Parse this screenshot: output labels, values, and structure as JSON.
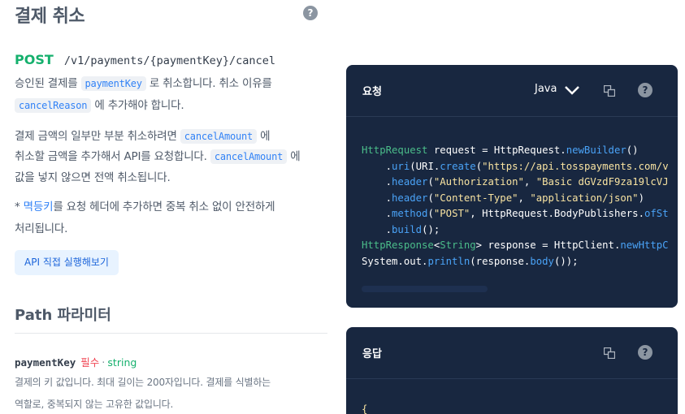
{
  "page": {
    "title": "결제 취소"
  },
  "endpoint": {
    "method": "POST",
    "path": "/v1/payments/{paymentKey}/cancel"
  },
  "description": {
    "p1_a": "승인된 결제를 ",
    "p1_code": "paymentKey",
    "p1_b": " 로 취소합니다. 취소 이유를",
    "p1_code2": "cancelReason",
    "p1_c": " 에 추가해야 합니다.",
    "p2_a": "결제 금액의 일부만 부분 취소하려면 ",
    "p2_code": "cancelAmount",
    "p2_b": " 에",
    "p2_c": "취소할 금액을 추가해서 API를 요청합니다. ",
    "p2_code2": "cancelAmount",
    "p2_d": " 에",
    "p2_e": "값을 넣지 않으면 전액 취소됩니다.",
    "p3_a": "* ",
    "p3_link": "멱등키",
    "p3_b": "를 요청 헤더에 추가하면 중복 취소 없이 안전하게",
    "p3_c": "처리됩니다."
  },
  "buttons": {
    "api_try": "API 직접 실행해보기"
  },
  "path_params": {
    "title": "Path 파라미터",
    "items": [
      {
        "name": "paymentKey",
        "required": "필수",
        "separator": "·",
        "type": "string",
        "desc_line1": "결제의 키 값입니다. 최대 길이는 200자입니다. 결제를 식별하는",
        "desc_line2": "역할로, 중복되지 않는 고유한 값입니다."
      }
    ]
  },
  "request_panel": {
    "title": "요청",
    "language": "Java",
    "code": {
      "l1_type": "HttpRequest",
      "l1_a": " request = HttpRequest.",
      "l1_fn": "newBuilder",
      "l1_b": "()",
      "l2_a": "    .",
      "l2_fn": "uri",
      "l2_b": "(URI.",
      "l2_fn2": "create",
      "l2_c": "(",
      "l2_str": "\"https://api.tosspayments.com/v",
      "l3_a": "    .",
      "l3_fn": "header",
      "l3_b": "(",
      "l3_str": "\"Authorization\"",
      "l3_c": ", ",
      "l3_str2": "\"Basic dGVzdF9za19lcVJ",
      "l4_a": "    .",
      "l4_fn": "header",
      "l4_b": "(",
      "l4_str": "\"Content-Type\"",
      "l4_c": ", ",
      "l4_str2": "\"application/json\"",
      "l4_d": ")",
      "l5_a": "    .",
      "l5_fn": "method",
      "l5_b": "(",
      "l5_str": "\"POST\"",
      "l5_c": ", HttpRequest.BodyPublishers.",
      "l5_fn2": "ofSt",
      "l6_a": "    .",
      "l6_fn": "build",
      "l6_b": "();",
      "l7_type": "HttpResponse",
      "l7_a": "<",
      "l7_type2": "String",
      "l7_b": "> response = HttpClient.",
      "l7_fn": "newHttpC",
      "l8_a": "System.out.",
      "l8_fn": "println",
      "l8_b": "(response.",
      "l8_fn2": "body",
      "l8_c": "());"
    }
  },
  "response_panel": {
    "title": "응답",
    "code_first": "{"
  },
  "colors": {
    "accent_green": "#15b06d",
    "accent_blue": "#3182f6",
    "required_red": "#f04452",
    "panel_bg": "#182740"
  }
}
